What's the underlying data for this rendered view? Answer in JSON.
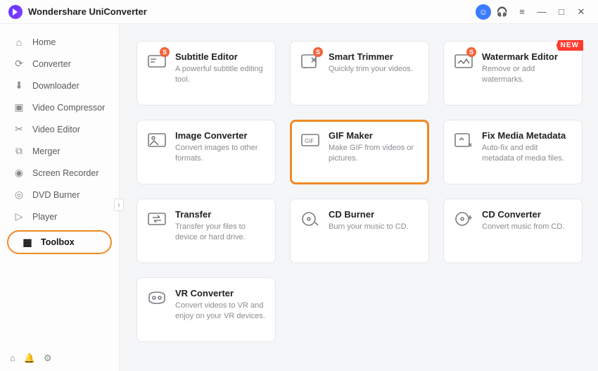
{
  "app": {
    "title": "Wondershare UniConverter"
  },
  "titlebar": {
    "avatar_glyph": "☺",
    "headset_glyph": "🎧",
    "menu_glyph": "≡",
    "minimize_glyph": "—",
    "maximize_glyph": "□",
    "close_glyph": "✕"
  },
  "collapse_glyph": "‹",
  "sidebar": {
    "items": [
      {
        "icon": "⌂",
        "label": "Home"
      },
      {
        "icon": "⟳",
        "label": "Converter"
      },
      {
        "icon": "⬇",
        "label": "Downloader"
      },
      {
        "icon": "▣",
        "label": "Video Compressor"
      },
      {
        "icon": "✂",
        "label": "Video Editor"
      },
      {
        "icon": "⧉",
        "label": "Merger"
      },
      {
        "icon": "◉",
        "label": "Screen Recorder"
      },
      {
        "icon": "◎",
        "label": "DVD Burner"
      },
      {
        "icon": "▷",
        "label": "Player"
      },
      {
        "icon": "▦",
        "label": "Toolbox"
      }
    ],
    "active_index": 9,
    "footer": {
      "home": "⌂",
      "bell": "🔔",
      "settings": "⚙"
    }
  },
  "cards": [
    {
      "title": "Subtitle Editor",
      "desc": "A powerful subtitle editing tool.",
      "s": true,
      "new": false
    },
    {
      "title": "Smart Trimmer",
      "desc": "Quickly trim your videos.",
      "s": true,
      "new": false
    },
    {
      "title": "Watermark Editor",
      "desc": "Remove or add watermarks.",
      "s": true,
      "new": true
    },
    {
      "title": "Image Converter",
      "desc": "Convert images to other formats.",
      "s": false,
      "new": false
    },
    {
      "title": "GIF Maker",
      "desc": "Make GIF from videos or pictures.",
      "s": false,
      "new": false
    },
    {
      "title": "Fix Media Metadata",
      "desc": "Auto-fix and edit metadata of media files.",
      "s": false,
      "new": false
    },
    {
      "title": "Transfer",
      "desc": "Transfer your files to device or hard drive.",
      "s": false,
      "new": false
    },
    {
      "title": "CD Burner",
      "desc": "Burn your music to CD.",
      "s": false,
      "new": false
    },
    {
      "title": "CD Converter",
      "desc": "Convert music from CD.",
      "s": false,
      "new": false
    },
    {
      "title": "VR Converter",
      "desc": "Convert videos to VR and enjoy on your VR devices.",
      "s": false,
      "new": false
    }
  ],
  "badges": {
    "s_label": "S",
    "new_label": "NEW"
  },
  "selected_card_index": 4
}
